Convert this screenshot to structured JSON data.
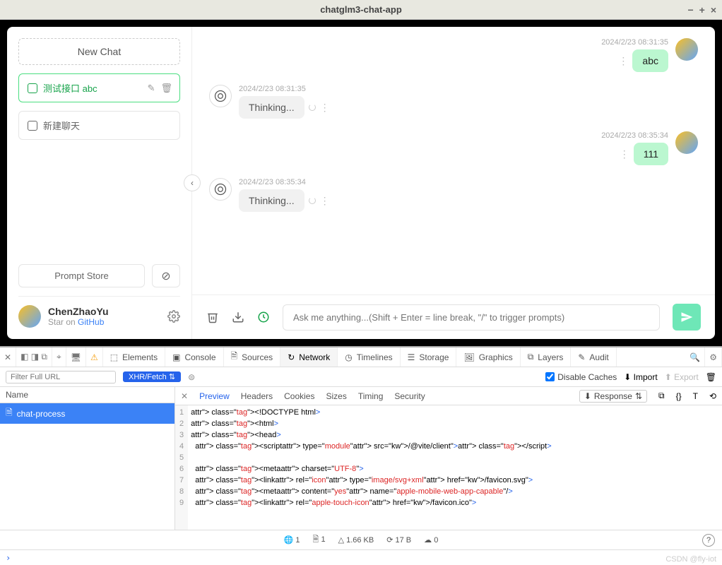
{
  "window": {
    "title": "chatglm3-chat-app"
  },
  "sidebar": {
    "newChat": "New Chat",
    "items": [
      {
        "label": "测试接口 abc"
      },
      {
        "label": "新建聊天"
      }
    ],
    "promptStore": "Prompt Store",
    "user": {
      "name": "ChenZhaoYu",
      "starOn": "Star on ",
      "github": "GitHub"
    }
  },
  "messages": [
    {
      "role": "user",
      "time": "2024/2/23 08:31:35",
      "text": "abc"
    },
    {
      "role": "bot",
      "time": "2024/2/23 08:31:35",
      "text": "Thinking..."
    },
    {
      "role": "user",
      "time": "2024/2/23 08:35:34",
      "text": "111"
    },
    {
      "role": "bot",
      "time": "2024/2/23 08:35:34",
      "text": "Thinking..."
    }
  ],
  "input": {
    "placeholder": "Ask me anything...(Shift + Enter = line break, \"/\" to trigger prompts)"
  },
  "devtools": {
    "panels": {
      "elements": "Elements",
      "console": "Console",
      "sources": "Sources",
      "network": "Network",
      "timelines": "Timelines",
      "storage": "Storage",
      "graphics": "Graphics",
      "layers": "Layers",
      "audit": "Audit"
    },
    "filterPlaceholder": "Filter Full URL",
    "xhrPill": "XHR/Fetch",
    "disableCaches": "Disable Caches",
    "import": "Import",
    "export": "Export",
    "nameHeader": "Name",
    "request": "chat-process",
    "tabs": {
      "preview": "Preview",
      "headers": "Headers",
      "cookies": "Cookies",
      "sizes": "Sizes",
      "timing": "Timing",
      "security": "Security"
    },
    "responseLabel": "Response",
    "status": {
      "requests": "1",
      "docs": "1",
      "size": "1.66 KB",
      "time": "17 B",
      "errors": "0"
    },
    "codeLines": [
      "<!DOCTYPE html>",
      "<html>",
      "<head>",
      "  <script type=\"module\" src=\"/@vite/client\"></script>",
      "",
      "  <meta charset=\"UTF-8\">",
      "  <link rel=\"icon\" type=\"image/svg+xml\" href=\"/favicon.svg\">",
      "  <meta content=\"yes\" name=\"apple-mobile-web-app-capable\"/>",
      "  <link rel=\"apple-touch-icon\" href=\"/favicon.ico\">"
    ]
  },
  "watermark": "CSDN @fly-iot"
}
